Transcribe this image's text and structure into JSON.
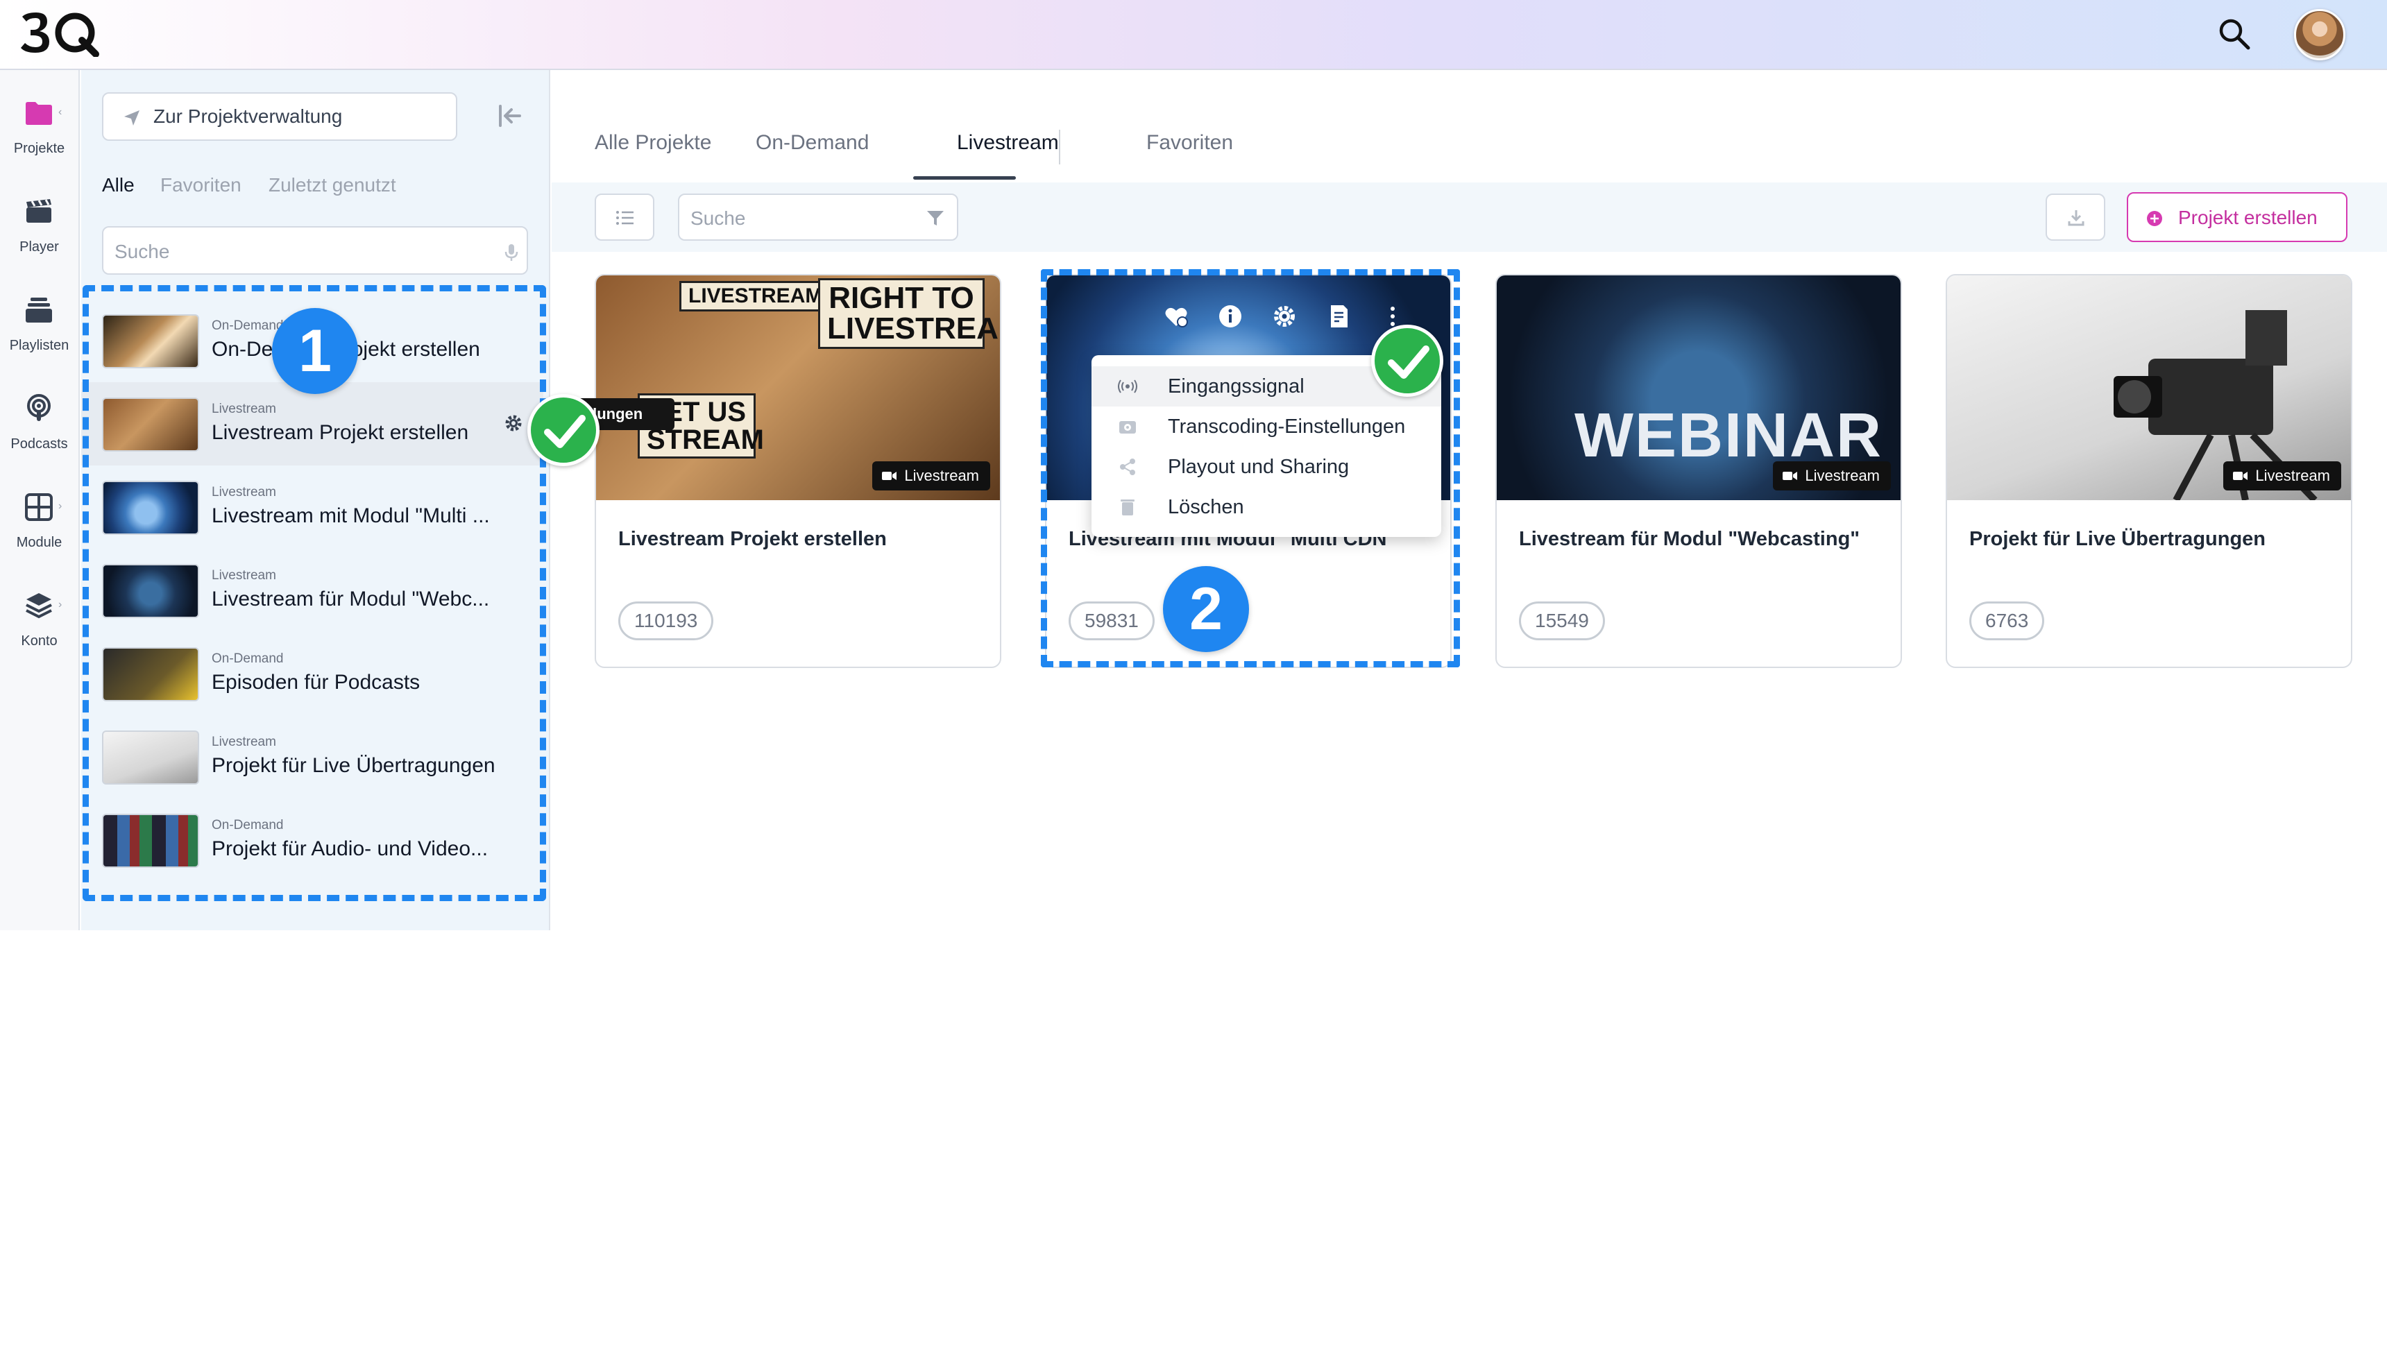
{
  "header": {
    "logo_text": "3Q",
    "search_icon": "search-icon",
    "avatar": "user-avatar"
  },
  "rail": {
    "items": [
      {
        "label": "Projekte",
        "icon": "folder-icon",
        "color": "#d63ab1"
      },
      {
        "label": "Player",
        "icon": "clapperboard-icon"
      },
      {
        "label": "Playlisten",
        "icon": "stack-icon"
      },
      {
        "label": "Podcasts",
        "icon": "podcast-icon"
      },
      {
        "label": "Module",
        "icon": "grid-icon"
      },
      {
        "label": "Konto",
        "icon": "layers-icon"
      }
    ]
  },
  "sidebar": {
    "manage_button": "Zur Projektverwaltung",
    "tabs": [
      "Alle",
      "Favoriten",
      "Zuletzt genutzt"
    ],
    "search_placeholder": "Suche",
    "items": [
      {
        "type": "On-Demand",
        "title": "On-Demand Projekt erstellen"
      },
      {
        "type": "Livestream",
        "title": "Livestream Projekt erstellen"
      },
      {
        "type": "Livestream",
        "title": "Livestream mit Modul \"Multi ..."
      },
      {
        "type": "Livestream",
        "title": "Livestream für Modul \"Webc..."
      },
      {
        "type": "On-Demand",
        "title": "Episoden für Podcasts"
      },
      {
        "type": "Livestream",
        "title": "Projekt für Live Übertragungen"
      },
      {
        "type": "On-Demand",
        "title": "Projekt für Audio- und Video..."
      }
    ],
    "tooltip": "Einstellungen"
  },
  "main": {
    "tabs": [
      "Alle Projekte",
      "On-Demand",
      "Livestream",
      "Favoriten"
    ],
    "active_tab": "Livestream",
    "search_placeholder": "Suche",
    "create_button": "Projekt erstellen",
    "cards": [
      {
        "title": "Livestream Projekt erstellen",
        "id": "110193",
        "badge": "Livestream",
        "thumb_text_1": "LIVESTREAMS",
        "thumb_text_2": "RIGHT TO LIVESTREAM",
        "thumb_text_3": "LET US STREAM"
      },
      {
        "title": "Livestream mit Modul \"Multi CDN\"",
        "id": "59831",
        "badge": ""
      },
      {
        "title": "Livestream für Modul \"Webcasting\"",
        "id": "15549",
        "badge": "Livestream",
        "thumb_text_1": "WEBINAR"
      },
      {
        "title": "Projekt für Live Übertragungen",
        "id": "6763",
        "badge": "Livestream"
      }
    ]
  },
  "context_menu": {
    "items": [
      "Eingangssignal",
      "Transcoding-Einstellungen",
      "Playout und Sharing",
      "Löschen"
    ]
  },
  "annotations": {
    "step1": "1",
    "step2": "2"
  },
  "colors": {
    "accent": "#d63ab1",
    "annotation_blue": "#1f86f0",
    "check_green": "#2bb24c"
  }
}
